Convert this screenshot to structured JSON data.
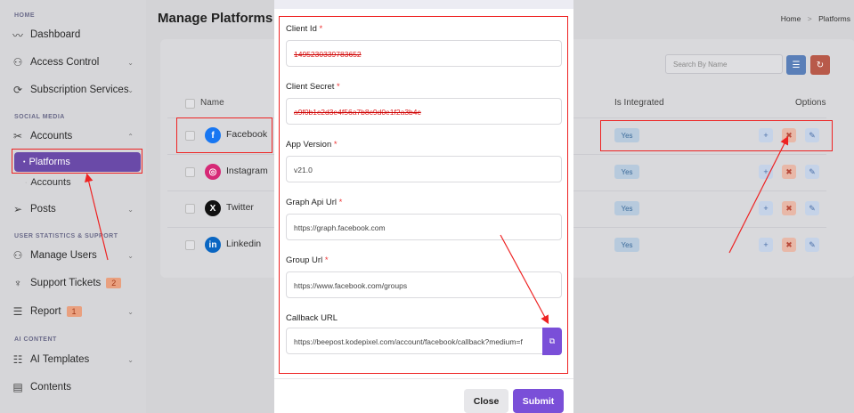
{
  "sidebar": {
    "sections": {
      "home": "HOME",
      "social": "SOCIAL MEDIA",
      "stats": "USER STATISTICS & SUPPORT",
      "ai": "AI CONTENT"
    },
    "items": {
      "dashboard": "Dashboard",
      "access": "Access Control",
      "subscription": "Subscription Services",
      "accounts": "Accounts",
      "platforms": "Platforms",
      "accounts_sub": "Accounts",
      "posts": "Posts",
      "manage_users": "Manage Users",
      "support": "Support Tickets",
      "support_count": "2",
      "report": "Report",
      "report_count": "1",
      "ai_templates": "AI Templates",
      "contents": "Contents"
    }
  },
  "main": {
    "title": "Manage Platforms",
    "breadcrumb": {
      "home": "Home",
      "sep": ">",
      "current": "Platforms"
    },
    "search_placeholder": "Search By Name",
    "columns": {
      "name": "Name",
      "integrated": "Is Integrated",
      "options": "Options"
    },
    "rows": [
      {
        "name": "Facebook",
        "integrated": "Yes",
        "color": "#1877f2",
        "glyph": "f"
      },
      {
        "name": "Instagram",
        "integrated": "Yes",
        "color": "#d62976",
        "glyph": "◎"
      },
      {
        "name": "Twitter",
        "integrated": "Yes",
        "color": "#111111",
        "glyph": "X"
      },
      {
        "name": "Linkedin",
        "integrated": "Yes",
        "color": "#0a66c2",
        "glyph": "in"
      }
    ]
  },
  "modal": {
    "client_id_label": "Client Id",
    "client_id_value": "1495230339783652",
    "client_secret_label": "Client Secret",
    "client_secret_value": "a9f0b1c2d3e4f56a7b8c9d0e1f2a3b4c",
    "app_version_label": "App Version",
    "app_version_value": "v21.0",
    "graph_api_label": "Graph Api Url",
    "graph_api_value": "https://graph.facebook.com",
    "group_url_label": "Group Url",
    "group_url_value": "https://www.facebook.com/groups",
    "callback_label": "Callback URL",
    "callback_value": "https://beepost.kodepixel.com/account/facebook/callback?medium=f",
    "required_mark": "*",
    "close_label": "Close",
    "submit_label": "Submit"
  }
}
